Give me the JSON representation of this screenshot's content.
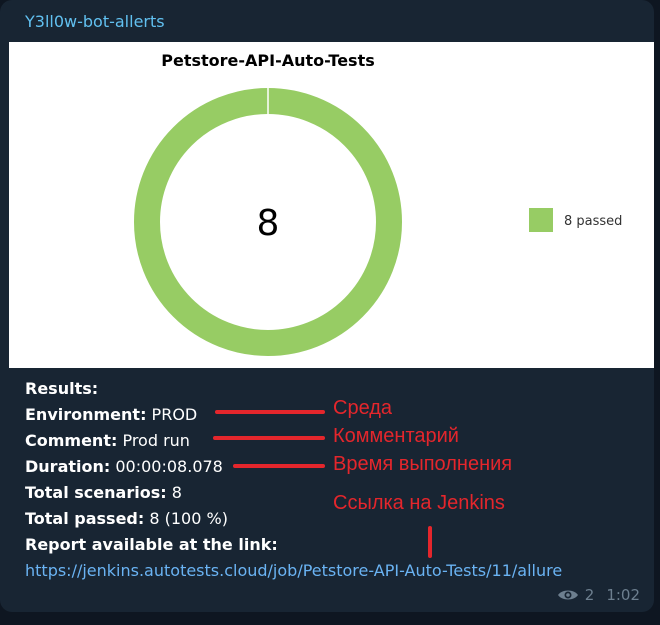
{
  "message": {
    "sender": "Y3ll0w-bot-allerts",
    "lines": [
      {
        "label": "Results:",
        "value": ""
      },
      {
        "label": "Environment:",
        "value": " PROD"
      },
      {
        "label": "Comment:",
        "value": " Prod run"
      },
      {
        "label": "Duration:",
        "value": " 00:00:08.078"
      },
      {
        "label": "Total scenarios:",
        "value": " 8"
      },
      {
        "label": "Total passed:",
        "value": " 8 (100 %)"
      },
      {
        "label": "Report available at the link:",
        "value": ""
      }
    ],
    "link": "https://jenkins.autotests.cloud/job/Petstore-API-Auto-Tests/11/allure",
    "views": "2",
    "time": "1:02",
    "views_icon": "eye-icon"
  },
  "annotations": {
    "environment": "Среда",
    "comment": "Комментарий",
    "duration": "Время выполнения",
    "jenkins": "Ссылка на Jenkins",
    "color": "#e4262c"
  },
  "chart_data": {
    "type": "pie",
    "title": "Petstore-API-Auto-Tests",
    "center_label": "8",
    "series": [
      {
        "name": "8 passed",
        "value": 8,
        "color": "#97cc64"
      }
    ],
    "legend": "right"
  }
}
